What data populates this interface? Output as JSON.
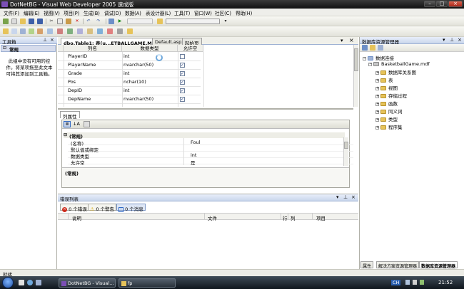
{
  "window": {
    "title": "DotNetBG - Visual Web Developer 2005 速成版"
  },
  "menu": [
    "文件(F)",
    "编辑(E)",
    "视图(V)",
    "项目(P)",
    "生成(B)",
    "调试(D)",
    "数据(A)",
    "表设计器(L)",
    "工具(T)",
    "窗口(W)",
    "社区(C)",
    "帮助(H)"
  ],
  "toolbox": {
    "title": "工具箱",
    "section": "常规",
    "empty_text": "此组中没有可用的控件。将某项拖至此文本可将其添加到工具箱。"
  },
  "doc_tabs": [
    "dbo.Table1: 表(u...ETBALLGAME.MDF)*",
    "Default.aspx",
    "起始页"
  ],
  "designer": {
    "headers": {
      "name": "列名",
      "type": "数据类型",
      "nulls": "允许空"
    },
    "rows": [
      {
        "name": "PlayerID",
        "type": "int",
        "nulls": false
      },
      {
        "name": "PlayerName",
        "type": "nvarchar(50)",
        "nulls": true
      },
      {
        "name": "Grade",
        "type": "int",
        "nulls": true
      },
      {
        "name": "Pos",
        "type": "nchar(10)",
        "nulls": true
      },
      {
        "name": "DepID",
        "type": "int",
        "nulls": true
      },
      {
        "name": "DepName",
        "type": "nvarchar(50)",
        "nulls": true
      }
    ]
  },
  "column_properties": {
    "tab": "列属性",
    "group": "(常规)",
    "rows": [
      {
        "key": "(名称)",
        "value": "Foul"
      },
      {
        "key": "默认值或绑定",
        "value": ""
      },
      {
        "key": "数据类型",
        "value": "int"
      },
      {
        "key": "允许空",
        "value": "是"
      }
    ],
    "description": "(常规)"
  },
  "error_list": {
    "title": "错误列表",
    "filters": [
      "0 个错误",
      "0 个警告",
      "0 个消息"
    ],
    "columns": [
      "说明",
      "文件",
      "行",
      "列",
      "项目"
    ]
  },
  "db_explorer": {
    "title": "数据库资源管理器",
    "root": "数据连接",
    "db": "BasketballGame.mdf",
    "folders": [
      "数据库关系图",
      "表",
      "视图",
      "存储过程",
      "函数",
      "同义词",
      "类型",
      "程序集"
    ],
    "bottom_tabs": [
      "属性",
      "解决方案资源管理器",
      "数据库资源管理器"
    ]
  },
  "status": {
    "text": "就绪"
  },
  "taskbar": {
    "items": [
      "DotNetBG - Visual...",
      "fp"
    ],
    "lang": "CH",
    "time": "21:52"
  },
  "colors": {
    "accent": "#316ac5",
    "panel_head": "#c9d6ec",
    "folder": "#e6c35a",
    "error_icon": "#cc2a1a",
    "warning_icon": "#f0c000"
  }
}
